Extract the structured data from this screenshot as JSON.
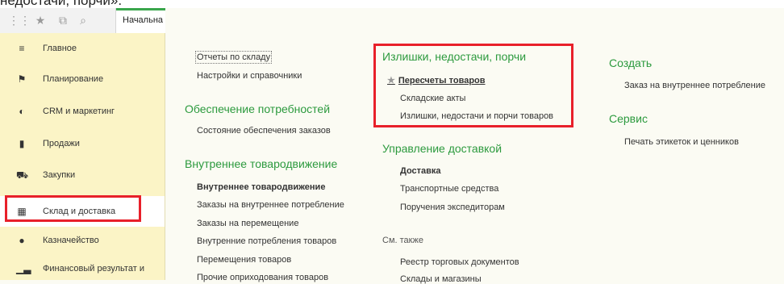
{
  "header_text": "недостачи, порчи».",
  "toolbar": {
    "icons": [
      "apps-grid-icon",
      "star-icon",
      "history-icon",
      "search-icon"
    ],
    "home_tab": "Начальна"
  },
  "sidebar": {
    "items": [
      {
        "label": "Главное",
        "icon": "menu-icon"
      },
      {
        "label": "Планирование",
        "icon": "planning-icon"
      },
      {
        "label": "CRM и маркетинг",
        "icon": "crm-icon"
      },
      {
        "label": "Продажи",
        "icon": "bag-icon"
      },
      {
        "label": "Закупки",
        "icon": "cart-icon"
      },
      {
        "label": "Склад и доставка",
        "icon": "warehouse-icon"
      },
      {
        "label": "Казначейство",
        "icon": "treasury-icon"
      },
      {
        "label": "Финансовый результат и",
        "icon": "chart-icon"
      }
    ]
  },
  "col1": {
    "top_links": [
      "Отчеты по складу",
      "Настройки и справочники"
    ],
    "section1": "Обеспечение потребностей",
    "section1_links": [
      "Состояние обеспечения заказов"
    ],
    "section2": "Внутреннее товародвижение",
    "section2_links": [
      "Внутреннее товародвижение",
      "Заказы на внутреннее потребление",
      "Заказы на перемещение",
      "Внутренние потребления товаров",
      "Перемещения товаров",
      "Прочие оприходования товаров"
    ]
  },
  "col2": {
    "section1": "Излишки, недостачи, порчи",
    "section1_links": [
      "Пересчеты товаров",
      "Складские акты",
      "Излишки, недостачи и порчи товаров"
    ],
    "section2": "Управление доставкой",
    "section2_links": [
      "Доставка",
      "Транспортные средства",
      "Поручения экспедиторам"
    ],
    "section3": "См. также",
    "section3_links": [
      "Реестр торговых документов",
      "Склады и магазины"
    ]
  },
  "col3": {
    "section1": "Создать",
    "section1_links": [
      "Заказ на внутреннее потребление"
    ],
    "section2": "Сервис",
    "section2_links": [
      "Печать этикеток и ценников"
    ]
  }
}
